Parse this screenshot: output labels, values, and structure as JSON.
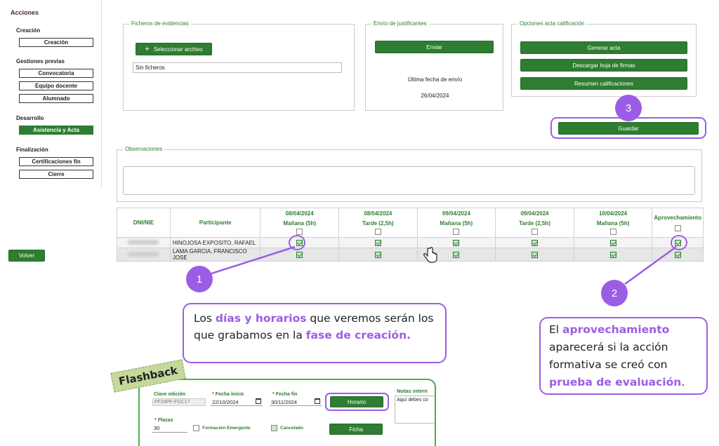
{
  "sidebar": {
    "title": "Acciones",
    "sections": [
      {
        "heading": "Creación",
        "items": [
          "Creación"
        ]
      },
      {
        "heading": "Gestiones previas",
        "items": [
          "Convocatoria",
          "Equipo docente",
          "Alumnado"
        ]
      },
      {
        "heading": "Desarrollo",
        "items": [
          "Asistencia y Acta"
        ]
      },
      {
        "heading": "Finalización",
        "items": [
          "Certificaciones fin",
          "Cierre"
        ]
      }
    ],
    "back_label": "Volver"
  },
  "evidencias": {
    "legend": "Ficheros de evidencias",
    "button": "Seleccionar archivo",
    "value": "Sin ficheros"
  },
  "justificantes": {
    "legend": "Envío de justificantes",
    "button": "Enviar",
    "last_label": "Última fecha de envío",
    "last_date": "26/04/2024"
  },
  "acta": {
    "legend": "Opciones acta calificación",
    "buttons": [
      "Generar acta",
      "Descargar hoja de firmas",
      "Resumen calificaciones"
    ]
  },
  "save_label": "Guardar",
  "observaciones": {
    "legend": "Observaciones"
  },
  "table": {
    "col_dni": "DNI/NIE",
    "col_participante": "Participante",
    "sessions": [
      {
        "date": "08/04/2024",
        "slot": "Mañana (5h)"
      },
      {
        "date": "08/04/2024",
        "slot": "Tarde (2,5h)"
      },
      {
        "date": "09/04/2024",
        "slot": "Mañana (5h)"
      },
      {
        "date": "09/04/2024",
        "slot": "Tarde (2,5h)"
      },
      {
        "date": "10/04/2024",
        "slot": "Mañana (5h)"
      }
    ],
    "col_aprovechamiento": "Aprovechamiento",
    "rows": [
      {
        "name": "HINOJOSA EXPOSITO, RAFAEL"
      },
      {
        "name": "LAMA GARCIA, FRANCISCO JOSE"
      }
    ]
  },
  "callouts": {
    "n1": "1",
    "n2": "2",
    "n3": "3",
    "c1": {
      "t1": "Los ",
      "h1": "días y horarios",
      "t2": " que veremos serán los que grabamos en la ",
      "h2": "fase de creación."
    },
    "c2": {
      "t1": "El ",
      "h1": "aprovechamiento",
      "t2": " aparecerá si la acción formativa se creó con ",
      "h2": "prueba de evaluación",
      "t3": "."
    }
  },
  "flashback": {
    "tag": "Flashback",
    "clave_label": "Clave edición",
    "clave_value": "PF24PF-FGC17",
    "fi_label": "Fecha inicio",
    "fi_value": "22/10/2024",
    "ff_label": "Fecha fin",
    "ff_value": "30/11/2024",
    "horario_button": "Horario",
    "notas_label": "Notas intern",
    "notas_value": "Aquí debes co",
    "plazas_label": "Plazas",
    "plazas_value": "30",
    "emergente_label": "Formación Emergente",
    "cancelado_label": "Cancelado",
    "ficha_button": "Ficha",
    "required_mark": "*"
  },
  "colors": {
    "accent": "#2e7d32",
    "highlight": "#9b5de5"
  }
}
